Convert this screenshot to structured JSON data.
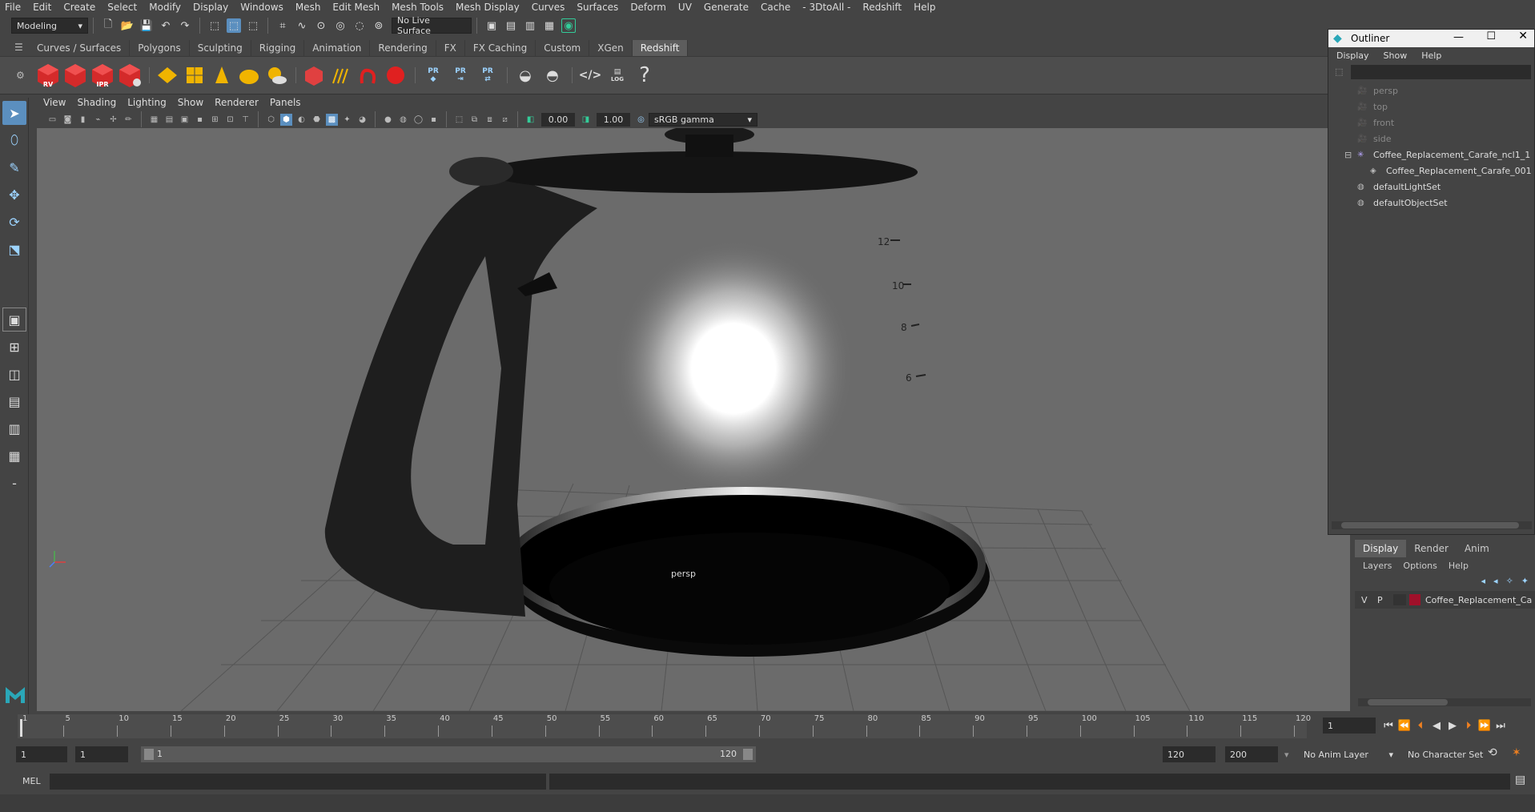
{
  "menubar": [
    "File",
    "Edit",
    "Create",
    "Select",
    "Modify",
    "Display",
    "Windows",
    "Mesh",
    "Edit Mesh",
    "Mesh Tools",
    "Mesh Display",
    "Curves",
    "Surfaces",
    "Deform",
    "UV",
    "Generate",
    "Cache",
    "- 3DtoAll -",
    "Redshift",
    "Help"
  ],
  "status": {
    "mode": "Modeling",
    "live_surface": "No Live Surface"
  },
  "shelf_tabs": [
    {
      "label": "Curves / Surfaces"
    },
    {
      "label": "Polygons"
    },
    {
      "label": "Sculpting"
    },
    {
      "label": "Rigging"
    },
    {
      "label": "Animation"
    },
    {
      "label": "Rendering"
    },
    {
      "label": "FX"
    },
    {
      "label": "FX Caching"
    },
    {
      "label": "Custom"
    },
    {
      "label": "XGen"
    },
    {
      "label": "Redshift",
      "active": true
    }
  ],
  "shelf": {
    "rv": "RV",
    "ipr": "IPR",
    "pr1": "PR",
    "pr2": "PR",
    "pr3": "PR",
    "log": "LOG",
    "help": "?"
  },
  "viewport": {
    "menu": [
      "View",
      "Shading",
      "Lighting",
      "Show",
      "Renderer",
      "Panels"
    ],
    "exposure": "0.00",
    "gamma": "1.00",
    "colorspace": "sRGB gamma",
    "camera_label": "persp",
    "carafe_marks": [
      "12",
      "10",
      "8",
      "6"
    ]
  },
  "outliner": {
    "title": "Outliner",
    "menu": [
      "Display",
      "Show",
      "Help"
    ],
    "items": [
      {
        "label": "persp",
        "icon": "camera-icon",
        "dim": true,
        "indent": 0
      },
      {
        "label": "top",
        "icon": "camera-icon",
        "dim": true,
        "indent": 0
      },
      {
        "label": "front",
        "icon": "camera-icon",
        "dim": true,
        "indent": 0
      },
      {
        "label": "side",
        "icon": "camera-icon",
        "dim": true,
        "indent": 0
      },
      {
        "label": "Coffee_Replacement_Carafe_ncl1_1",
        "icon": "group-icon",
        "dim": false,
        "indent": 0
      },
      {
        "label": "Coffee_Replacement_Carafe_001",
        "icon": "mesh-icon",
        "dim": false,
        "indent": 1
      },
      {
        "label": "defaultLightSet",
        "icon": "set-icon",
        "dim": false,
        "indent": 0
      },
      {
        "label": "defaultObjectSet",
        "icon": "set-icon",
        "dim": false,
        "indent": 0
      }
    ]
  },
  "layers": {
    "tabs": [
      {
        "label": "Display",
        "active": true
      },
      {
        "label": "Render"
      },
      {
        "label": "Anim"
      }
    ],
    "menu": [
      "Layers",
      "Options",
      "Help"
    ],
    "row": {
      "v": "V",
      "p": "P",
      "name": "Coffee_Replacement_Ca",
      "color": "#a0102a"
    }
  },
  "timeline": {
    "ticks": [
      "1",
      "5",
      "10",
      "15",
      "20",
      "25",
      "30",
      "35",
      "40",
      "45",
      "50",
      "55",
      "60",
      "65",
      "70",
      "75",
      "80",
      "85",
      "90",
      "95",
      "100",
      "105",
      "110",
      "115",
      "120"
    ],
    "current_frame": "1"
  },
  "range": {
    "start": "1",
    "anim_start": "1",
    "slider_start": "1",
    "slider_end": "120",
    "anim_end": "120",
    "end": "200",
    "anim_layer": "No Anim Layer",
    "char_set": "No Character Set"
  },
  "cmd": {
    "label": "MEL"
  },
  "colors": {
    "accent": "#5b8fbf",
    "redshift_red": "#d42a2a",
    "maya_orange": "#f0b400"
  }
}
